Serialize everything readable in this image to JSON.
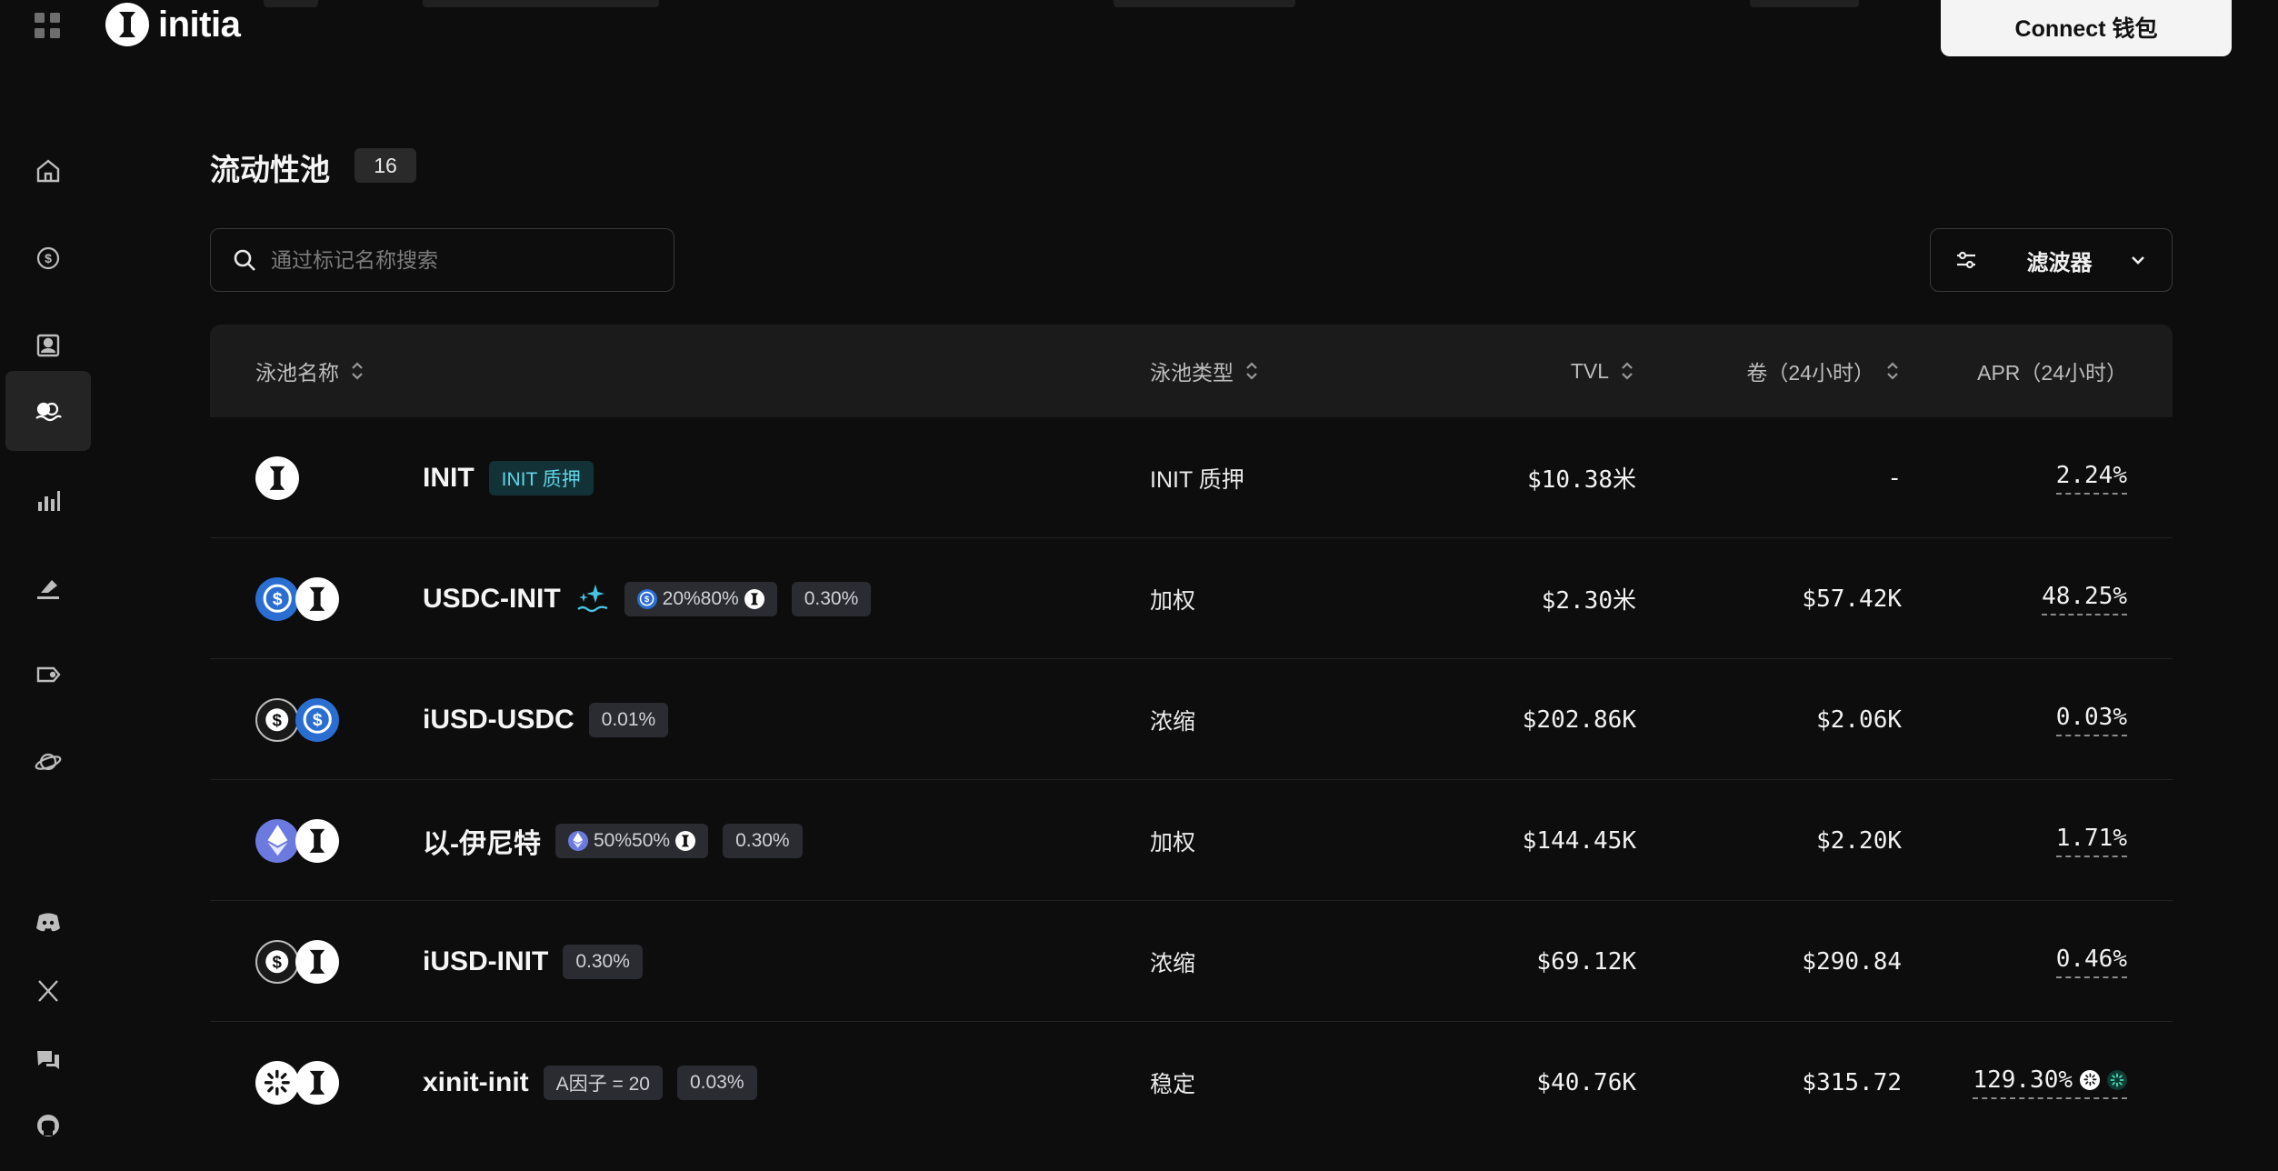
{
  "header": {
    "logo_text": "initia",
    "connect_label": "Connect 钱包"
  },
  "sidebar": {
    "items": [
      {
        "icon": "home-icon"
      },
      {
        "icon": "coin-swap-icon"
      },
      {
        "icon": "profile-icon"
      },
      {
        "icon": "liquidity-icon",
        "active": true
      },
      {
        "icon": "bar-chart-icon"
      },
      {
        "icon": "vote-icon"
      },
      {
        "icon": "tag-icon"
      },
      {
        "icon": "planet-icon"
      }
    ],
    "social": [
      "discord-icon",
      "x-icon",
      "forum-icon",
      "github-icon"
    ]
  },
  "page": {
    "title": "流动性池",
    "count": "16",
    "search_placeholder": "通过标记名称搜索",
    "filter_label": "滤波器"
  },
  "table": {
    "columns": {
      "name": "泳池名称",
      "type": "泳池类型",
      "tvl": "TVL",
      "volume": "卷（24小时）",
      "apr": "APR（24小时）"
    },
    "rows": [
      {
        "tokens": [
          "init"
        ],
        "name": "INIT",
        "tags": [
          {
            "text": "INIT 质押",
            "style": "teal"
          }
        ],
        "type": "INIT 质押",
        "tvl": "$10.38米",
        "volume": "-",
        "apr": "2.24%"
      },
      {
        "tokens": [
          "usdc",
          "init"
        ],
        "name": "USDC-INIT",
        "sparkle": true,
        "tags": [
          {
            "text": "20%80%",
            "icons": [
              "usdc",
              "init"
            ]
          },
          {
            "text": "0.30%"
          }
        ],
        "type": "加权",
        "tvl": "$2.30米",
        "volume": "$57.42K",
        "apr": "48.25%"
      },
      {
        "tokens": [
          "iusd",
          "usdc"
        ],
        "name": "iUSD-USDC",
        "tags": [
          {
            "text": "0.01%"
          }
        ],
        "type": "浓缩",
        "tvl": "$202.86K",
        "volume": "$2.06K",
        "apr": "0.03%"
      },
      {
        "tokens": [
          "eth",
          "init"
        ],
        "name": "以-伊尼特",
        "tags": [
          {
            "text": "50%50%",
            "icons": [
              "eth",
              "init"
            ]
          },
          {
            "text": "0.30%"
          }
        ],
        "type": "加权",
        "tvl": "$144.45K",
        "volume": "$2.20K",
        "apr": "1.71%"
      },
      {
        "tokens": [
          "iusd",
          "init"
        ],
        "name": "iUSD-INIT",
        "tags": [
          {
            "text": "0.30%"
          }
        ],
        "type": "浓缩",
        "tvl": "$69.12K",
        "volume": "$290.84",
        "apr": "0.46%"
      },
      {
        "tokens": [
          "xinit",
          "init"
        ],
        "name": "xinit-init",
        "tags": [
          {
            "text": "A因子 = 20"
          },
          {
            "text": "0.03%"
          }
        ],
        "type": "稳定",
        "tvl": "$40.76K",
        "volume": "$315.72",
        "apr": "129.30%",
        "apr_icons": [
          "xinit",
          "xinit-green"
        ]
      }
    ]
  },
  "colors": {
    "background": "#0d0d0d",
    "header_row": "#1b1b1b",
    "accent_teal": "#5fd6e6",
    "usdc_blue": "#2b6ed2",
    "eth_purple": "#6c7ae0"
  }
}
